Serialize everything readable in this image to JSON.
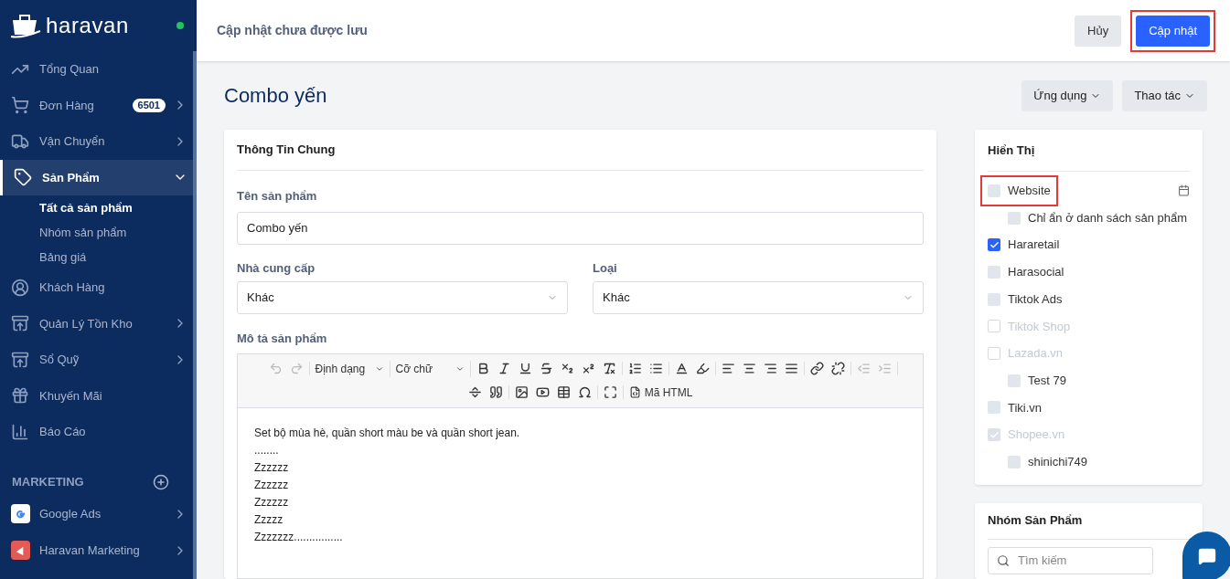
{
  "sidebar": {
    "logo": "haravan",
    "online": true,
    "items": [
      {
        "label": "Tổng Quan",
        "selected": false
      },
      {
        "label": "Đơn Hàng",
        "badge": "6501",
        "selected": false,
        "expanded": false
      },
      {
        "label": "Vận Chuyển",
        "selected": false,
        "expanded": false
      },
      {
        "label": "Sản Phẩm",
        "selected": true,
        "expanded": true,
        "children": [
          {
            "label": "Tất cả sản phẩm",
            "selected": true
          },
          {
            "label": "Nhóm sản phẩm",
            "selected": false
          },
          {
            "label": "Bảng giá",
            "selected": false
          }
        ]
      },
      {
        "label": "Khách Hàng",
        "selected": false
      },
      {
        "label": "Quản Lý Tồn Kho",
        "selected": false,
        "expanded": false
      },
      {
        "label": "Sổ Quỹ",
        "selected": false,
        "expanded": false
      },
      {
        "label": "Khuyến Mãi",
        "selected": false
      },
      {
        "label": "Báo Cáo",
        "selected": false
      }
    ],
    "section": "MARKETING",
    "apps": [
      {
        "label": "Google Ads",
        "expanded": false
      },
      {
        "label": "Haravan Marketing",
        "expanded": false
      }
    ]
  },
  "header": {
    "title": "Cập nhật chưa được lưu",
    "cancel": "Hủy",
    "save": "Cập nhật",
    "save_highlighted": true
  },
  "page": {
    "title": "Combo yến",
    "actions": [
      "Ứng dụng",
      "Thao tác"
    ]
  },
  "general": {
    "title": "Thông Tin Chung",
    "name_label": "Tên sản phẩm",
    "name": "Combo yến",
    "vendor_label": "Nhà cung cấp",
    "vendor": "Khác",
    "type_label": "Loại",
    "type": "Khác",
    "desc_label": "Mô tả sản phẩm",
    "toolbar": {
      "format": "Định dạng",
      "size": "Cỡ chữ",
      "html": "Mã HTML"
    },
    "content": [
      "Set bộ mùa hè, quần short màu be và quần short jean.",
      "........",
      "Zzzzzz",
      "Zzzzzz",
      "Zzzzzz",
      "Zzzzz",
      "Zzzzzzz................"
    ]
  },
  "visibility": {
    "title": "Hiển Thị",
    "channels": [
      {
        "label": "Website",
        "checked": false,
        "disabled": false,
        "highlighted": true,
        "children": [
          {
            "label": "Chỉ ẩn ở danh sách sản phẩm",
            "checked": false,
            "disabled": false
          }
        ]
      },
      {
        "label": "Hararetail",
        "checked": true,
        "disabled": false
      },
      {
        "label": "Harasocial",
        "checked": false,
        "disabled": false
      },
      {
        "label": "Tiktok Ads",
        "checked": false,
        "disabled": false
      },
      {
        "label": "Tiktok Shop",
        "checked": false,
        "disabled": true
      },
      {
        "label": "Lazada.vn",
        "checked": false,
        "disabled": true,
        "children": [
          {
            "label": "Test 79",
            "checked": false,
            "disabled": false
          }
        ]
      },
      {
        "label": "Tiki.vn",
        "checked": false,
        "disabled": false
      },
      {
        "label": "Shopee.vn",
        "checked": true,
        "disabled": true,
        "children": [
          {
            "label": "shinichi749",
            "checked": false,
            "disabled": false
          }
        ]
      }
    ]
  },
  "groups": {
    "title": "Nhóm Sản Phẩm",
    "search_placeholder": "Tìm kiếm"
  }
}
